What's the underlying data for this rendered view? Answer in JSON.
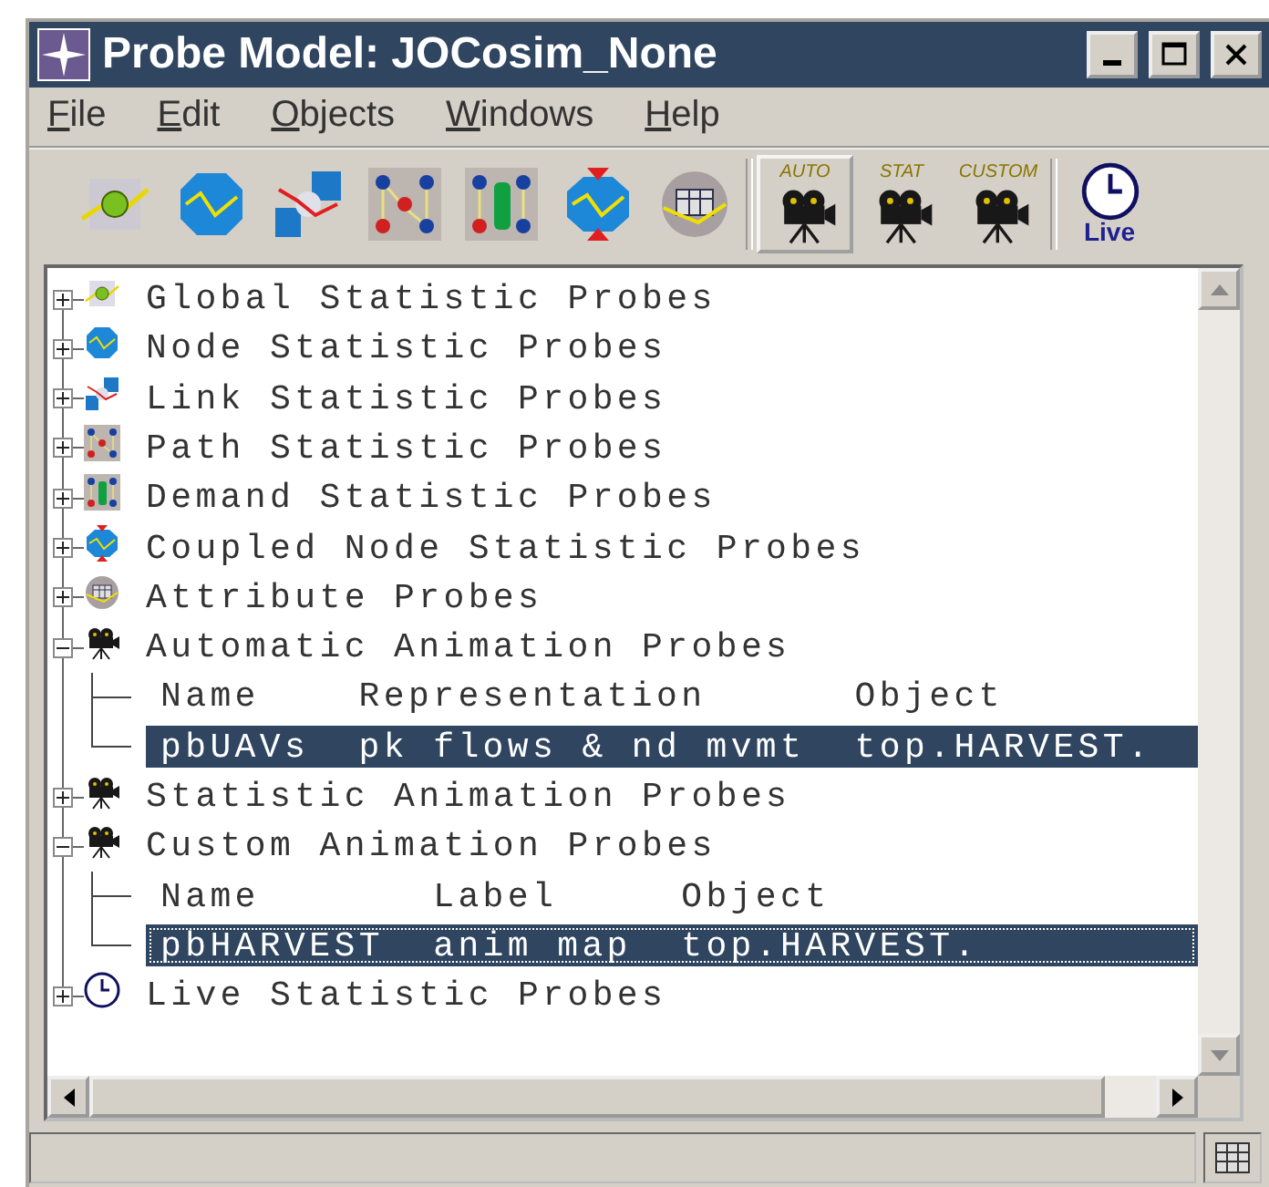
{
  "window": {
    "title": "Probe Model: JOCosim_None"
  },
  "menu": [
    {
      "label": "File"
    },
    {
      "label": "Edit"
    },
    {
      "label": "Objects"
    },
    {
      "label": "Windows"
    },
    {
      "label": "Help"
    }
  ],
  "toolbar": [
    {
      "kind": "global",
      "pressed": false
    },
    {
      "kind": "node",
      "pressed": false
    },
    {
      "kind": "link",
      "pressed": false
    },
    {
      "kind": "path",
      "pressed": false
    },
    {
      "kind": "demand",
      "pressed": false
    },
    {
      "kind": "coupled",
      "pressed": false
    },
    {
      "kind": "attribute",
      "pressed": false
    },
    {
      "kind": "camera",
      "label": "AUTO",
      "pressed": true
    },
    {
      "kind": "camera",
      "label": "STAT",
      "pressed": false
    },
    {
      "kind": "camera",
      "label": "CUSTOM",
      "pressed": false
    },
    {
      "kind": "clock",
      "label": "Live",
      "pressed": false
    }
  ],
  "tree": [
    {
      "label": "Global Statistic Probes",
      "kind": "global",
      "expanded": false
    },
    {
      "label": "Node Statistic Probes",
      "kind": "node",
      "expanded": false
    },
    {
      "label": "Link Statistic Probes",
      "kind": "link",
      "expanded": false
    },
    {
      "label": "Path Statistic Probes",
      "kind": "path",
      "expanded": false
    },
    {
      "label": "Demand Statistic Probes",
      "kind": "demand",
      "expanded": false
    },
    {
      "label": "Coupled Node Statistic Probes",
      "kind": "coupled",
      "expanded": false
    },
    {
      "label": "Attribute Probes",
      "kind": "attribute",
      "expanded": false
    },
    {
      "label": "Automatic Animation Probes",
      "kind": "camera",
      "expanded": true,
      "columns": [
        "Name",
        "Representation",
        "Object"
      ],
      "rows": [
        {
          "cells": [
            "pbUAVs",
            "pk flows & nd mvmt",
            "top.HARVEST."
          ],
          "selected": true,
          "focused": false
        }
      ]
    },
    {
      "label": "Statistic Animation Probes",
      "kind": "camera",
      "expanded": false
    },
    {
      "label": "Custom Animation Probes",
      "kind": "camera",
      "expanded": true,
      "columns": [
        "Name",
        "Label",
        "Object"
      ],
      "rows": [
        {
          "cells": [
            "pbHARVEST",
            "anim map",
            "top.HARVEST."
          ],
          "selected": true,
          "focused": true
        }
      ]
    },
    {
      "label": "Live Statistic Probes",
      "kind": "clock",
      "expanded": false
    }
  ]
}
